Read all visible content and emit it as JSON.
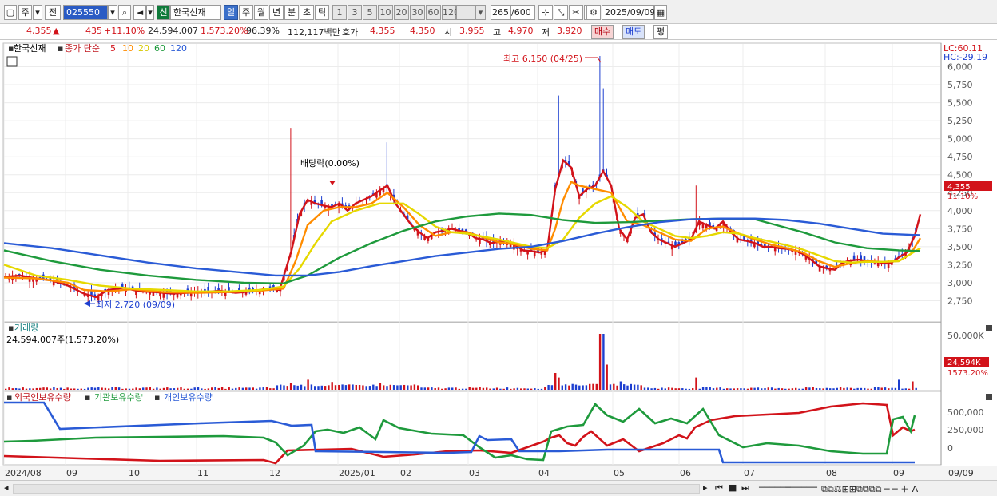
{
  "toolbar": {
    "period": "주",
    "prev": "전",
    "code": "025550",
    "credit": "신",
    "name": "한국선재",
    "intervals": [
      "일",
      "주",
      "월",
      "년",
      "분",
      "초",
      "틱"
    ],
    "active_interval": "일",
    "multipliers": [
      "1",
      "3",
      "5",
      "10",
      "20",
      "30",
      "60",
      "120"
    ],
    "count": "265",
    "count_total": "/600",
    "date": "2025/09/09"
  },
  "quote": {
    "price": "4,355",
    "change": "435",
    "change_pct": "+11.10%",
    "volume": "24,594,007",
    "volume_ratio": "1,573.20%",
    "turnover": "96.39%",
    "amount": "112,117백만",
    "bid_label": "호가",
    "ask": "4,355",
    "bid": "4,350",
    "open_label": "시",
    "open": "3,955",
    "high_label": "고",
    "high": "4,970",
    "low_label": "저",
    "low": "3,920",
    "buy_label": "매수",
    "sell_label": "매도",
    "eval_label": "평"
  },
  "chart_data": {
    "type": "line",
    "title": "한국선재",
    "legend": {
      "price": "종가 단순",
      "ma": [
        {
          "period": "5",
          "color": "#d2131a"
        },
        {
          "period": "10",
          "color": "#ff8c00"
        },
        {
          "period": "20",
          "color": "#e6d800"
        },
        {
          "period": "60",
          "color": "#1e9a3c"
        },
        {
          "period": "120",
          "color": "#2a5bd6"
        }
      ]
    },
    "lc_label": "LC:60.11",
    "hc_label": "HC:-29.19",
    "price_axis": {
      "ticks": [
        "6,000",
        "5,750",
        "5,500",
        "5,250",
        "5,000",
        "4,750",
        "4,500",
        "4,250",
        "4,000",
        "3,750",
        "3,500",
        "3,250",
        "3,000",
        "2,750"
      ],
      "ylim": [
        2600,
        6150
      ]
    },
    "x_ticks": [
      "2024/08",
      "09",
      "10",
      "11",
      "12",
      "2025/01",
      "02",
      "03",
      "04",
      "05",
      "06",
      "07",
      "08",
      "09",
      "09/09"
    ],
    "annotations": {
      "high": "최고 6,150 (04/25)",
      "low": "최저 2,720 (09/09)",
      "dividend": "배당락(0.00%)"
    },
    "last_price_label": "4,355",
    "last_change_label": "11.10%",
    "ma_series": [
      {
        "name": "MA5",
        "color": "#d2131a",
        "points": [
          [
            0,
            3080
          ],
          [
            20,
            3100
          ],
          [
            40,
            3060
          ],
          [
            60,
            3030
          ],
          [
            80,
            2960
          ],
          [
            100,
            2850
          ],
          [
            115,
            2800
          ],
          [
            130,
            2900
          ],
          [
            150,
            2930
          ],
          [
            170,
            2880
          ],
          [
            190,
            2870
          ],
          [
            210,
            2850
          ],
          [
            230,
            2860
          ],
          [
            250,
            2870
          ],
          [
            270,
            2890
          ],
          [
            290,
            2860
          ],
          [
            310,
            2880
          ],
          [
            330,
            2920
          ],
          [
            345,
            2900
          ],
          [
            360,
            3450
          ],
          [
            370,
            3950
          ],
          [
            380,
            4150
          ],
          [
            390,
            4100
          ],
          [
            400,
            4070
          ],
          [
            410,
            4050
          ],
          [
            420,
            4100
          ],
          [
            430,
            4000
          ],
          [
            440,
            4100
          ],
          [
            450,
            4150
          ],
          [
            460,
            4200
          ],
          [
            470,
            4280
          ],
          [
            480,
            4350
          ],
          [
            490,
            4100
          ],
          [
            500,
            3950
          ],
          [
            510,
            3800
          ],
          [
            520,
            3700
          ],
          [
            530,
            3620
          ],
          [
            540,
            3700
          ],
          [
            550,
            3720
          ],
          [
            560,
            3750
          ],
          [
            570,
            3720
          ],
          [
            580,
            3700
          ],
          [
            590,
            3620
          ],
          [
            600,
            3600
          ],
          [
            610,
            3550
          ],
          [
            620,
            3570
          ],
          [
            630,
            3580
          ],
          [
            640,
            3520
          ],
          [
            650,
            3450
          ],
          [
            660,
            3440
          ],
          [
            670,
            3420
          ],
          [
            680,
            3450
          ],
          [
            690,
            4300
          ],
          [
            700,
            4700
          ],
          [
            710,
            4600
          ],
          [
            720,
            4200
          ],
          [
            730,
            4300
          ],
          [
            740,
            4350
          ],
          [
            750,
            4550
          ],
          [
            760,
            4350
          ],
          [
            770,
            3750
          ],
          [
            780,
            3600
          ],
          [
            790,
            3900
          ],
          [
            800,
            3950
          ],
          [
            810,
            3700
          ],
          [
            820,
            3600
          ],
          [
            830,
            3550
          ],
          [
            840,
            3500
          ],
          [
            850,
            3550
          ],
          [
            860,
            3600
          ],
          [
            870,
            3850
          ],
          [
            880,
            3800
          ],
          [
            890,
            3750
          ],
          [
            900,
            3850
          ],
          [
            910,
            3700
          ],
          [
            920,
            3600
          ],
          [
            930,
            3580
          ],
          [
            940,
            3550
          ],
          [
            950,
            3500
          ],
          [
            960,
            3500
          ],
          [
            970,
            3480
          ],
          [
            980,
            3470
          ],
          [
            990,
            3450
          ],
          [
            1000,
            3400
          ],
          [
            1010,
            3320
          ],
          [
            1020,
            3230
          ],
          [
            1030,
            3200
          ],
          [
            1040,
            3180
          ],
          [
            1050,
            3280
          ],
          [
            1060,
            3310
          ],
          [
            1070,
            3320
          ],
          [
            1080,
            3300
          ],
          [
            1090,
            3290
          ],
          [
            1100,
            3280
          ],
          [
            1110,
            3270
          ],
          [
            1120,
            3350
          ],
          [
            1130,
            3420
          ],
          [
            1140,
            3650
          ],
          [
            1147,
            3950
          ]
        ]
      },
      {
        "name": "MA10",
        "color": "#ff8c00",
        "points": [
          [
            0,
            3070
          ],
          [
            40,
            3060
          ],
          [
            80,
            3000
          ],
          [
            100,
            2900
          ],
          [
            130,
            2880
          ],
          [
            160,
            2910
          ],
          [
            200,
            2870
          ],
          [
            240,
            2860
          ],
          [
            280,
            2870
          ],
          [
            320,
            2890
          ],
          [
            350,
            2920
          ],
          [
            365,
            3300
          ],
          [
            380,
            3800
          ],
          [
            400,
            4000
          ],
          [
            420,
            4050
          ],
          [
            440,
            4050
          ],
          [
            460,
            4100
          ],
          [
            480,
            4250
          ],
          [
            500,
            4050
          ],
          [
            520,
            3800
          ],
          [
            540,
            3650
          ],
          [
            560,
            3700
          ],
          [
            580,
            3700
          ],
          [
            600,
            3630
          ],
          [
            620,
            3560
          ],
          [
            640,
            3530
          ],
          [
            660,
            3470
          ],
          [
            680,
            3450
          ],
          [
            690,
            3750
          ],
          [
            700,
            4150
          ],
          [
            710,
            4400
          ],
          [
            720,
            4350
          ],
          [
            740,
            4300
          ],
          [
            760,
            4250
          ],
          [
            780,
            3850
          ],
          [
            800,
            3800
          ],
          [
            820,
            3700
          ],
          [
            840,
            3600
          ],
          [
            860,
            3580
          ],
          [
            880,
            3750
          ],
          [
            900,
            3780
          ],
          [
            920,
            3680
          ],
          [
            940,
            3600
          ],
          [
            960,
            3530
          ],
          [
            980,
            3480
          ],
          [
            1000,
            3420
          ],
          [
            1020,
            3300
          ],
          [
            1040,
            3220
          ],
          [
            1060,
            3270
          ],
          [
            1080,
            3300
          ],
          [
            1100,
            3290
          ],
          [
            1120,
            3300
          ],
          [
            1135,
            3400
          ],
          [
            1147,
            3620
          ]
        ]
      },
      {
        "name": "MA20",
        "color": "#e6d800",
        "points": [
          [
            0,
            3250
          ],
          [
            40,
            3100
          ],
          [
            80,
            3040
          ],
          [
            120,
            2960
          ],
          [
            160,
            2920
          ],
          [
            200,
            2900
          ],
          [
            240,
            2880
          ],
          [
            280,
            2880
          ],
          [
            320,
            2900
          ],
          [
            350,
            2950
          ],
          [
            370,
            3200
          ],
          [
            390,
            3550
          ],
          [
            410,
            3850
          ],
          [
            440,
            4000
          ],
          [
            470,
            4100
          ],
          [
            500,
            4100
          ],
          [
            520,
            3950
          ],
          [
            540,
            3780
          ],
          [
            560,
            3700
          ],
          [
            580,
            3680
          ],
          [
            600,
            3640
          ],
          [
            620,
            3600
          ],
          [
            640,
            3550
          ],
          [
            660,
            3500
          ],
          [
            680,
            3480
          ],
          [
            700,
            3600
          ],
          [
            720,
            3900
          ],
          [
            740,
            4100
          ],
          [
            760,
            4200
          ],
          [
            780,
            4050
          ],
          [
            800,
            3850
          ],
          [
            820,
            3750
          ],
          [
            840,
            3650
          ],
          [
            860,
            3620
          ],
          [
            880,
            3650
          ],
          [
            900,
            3700
          ],
          [
            920,
            3680
          ],
          [
            940,
            3620
          ],
          [
            960,
            3570
          ],
          [
            980,
            3520
          ],
          [
            1000,
            3460
          ],
          [
            1020,
            3380
          ],
          [
            1040,
            3300
          ],
          [
            1060,
            3280
          ],
          [
            1080,
            3290
          ],
          [
            1100,
            3290
          ],
          [
            1120,
            3300
          ],
          [
            1147,
            3480
          ]
        ]
      },
      {
        "name": "MA60",
        "color": "#1e9a3c",
        "points": [
          [
            0,
            3450
          ],
          [
            60,
            3300
          ],
          [
            120,
            3180
          ],
          [
            180,
            3100
          ],
          [
            240,
            3040
          ],
          [
            300,
            3000
          ],
          [
            350,
            2990
          ],
          [
            380,
            3100
          ],
          [
            420,
            3350
          ],
          [
            460,
            3550
          ],
          [
            500,
            3720
          ],
          [
            540,
            3850
          ],
          [
            580,
            3920
          ],
          [
            620,
            3960
          ],
          [
            660,
            3940
          ],
          [
            700,
            3870
          ],
          [
            740,
            3830
          ],
          [
            780,
            3840
          ],
          [
            820,
            3860
          ],
          [
            860,
            3880
          ],
          [
            900,
            3890
          ],
          [
            940,
            3880
          ],
          [
            960,
            3820
          ],
          [
            1000,
            3700
          ],
          [
            1040,
            3560
          ],
          [
            1080,
            3480
          ],
          [
            1120,
            3450
          ],
          [
            1147,
            3440
          ]
        ]
      },
      {
        "name": "MA120",
        "color": "#2a5bd6",
        "points": [
          [
            0,
            3550
          ],
          [
            60,
            3480
          ],
          [
            120,
            3380
          ],
          [
            180,
            3280
          ],
          [
            240,
            3200
          ],
          [
            300,
            3140
          ],
          [
            340,
            3100
          ],
          [
            380,
            3100
          ],
          [
            420,
            3150
          ],
          [
            460,
            3230
          ],
          [
            500,
            3300
          ],
          [
            540,
            3370
          ],
          [
            580,
            3420
          ],
          [
            620,
            3470
          ],
          [
            660,
            3500
          ],
          [
            700,
            3580
          ],
          [
            740,
            3680
          ],
          [
            780,
            3770
          ],
          [
            820,
            3840
          ],
          [
            860,
            3880
          ],
          [
            900,
            3890
          ],
          [
            940,
            3890
          ],
          [
            980,
            3870
          ],
          [
            1020,
            3820
          ],
          [
            1060,
            3750
          ],
          [
            1100,
            3680
          ],
          [
            1147,
            3660
          ]
        ]
      }
    ],
    "volume_panel": {
      "title": "거래량",
      "readout": "24,594,007주(1,573.20%)",
      "ticks": [
        "50,000K"
      ],
      "last_label": "24,594K",
      "last_pct": "1573.20%"
    },
    "holdings_panel": {
      "series": [
        {
          "name": "외국인보유수량",
          "color": "#d2131a"
        },
        {
          "name": "기관보유수량",
          "color": "#1e9a3c"
        },
        {
          "name": "개인보유수량",
          "color": "#2a5bd6"
        }
      ],
      "ticks": [
        "500,000",
        "250,000",
        "0"
      ]
    }
  }
}
